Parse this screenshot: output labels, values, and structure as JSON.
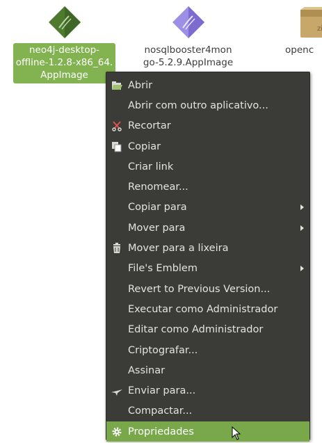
{
  "desktop": {
    "files": [
      {
        "name": "neo4j-desktop-\noffline-1.2.8-x86_64.\nAppImage",
        "icon": "neo4j-diamond-icon",
        "icon_color": "#4e7a2f",
        "selected": true
      },
      {
        "name": "nosqlbooster4mon\ngo-5.2.9.AppImage",
        "icon": "nosqlbooster-diamond-icon",
        "icon_color": "#8a7ad8",
        "selected": false
      },
      {
        "name": "openc",
        "icon": "zip-archive-icon",
        "icon_color": "#c8a86a",
        "selected": false
      }
    ],
    "zip_icon_text": "zip"
  },
  "context_menu": {
    "items": [
      {
        "label": "Abrir",
        "icon": "open-icon",
        "submenu": false
      },
      {
        "label": "Abrir com outro aplicativo...",
        "icon": "",
        "submenu": false
      },
      {
        "label": "Recortar",
        "icon": "scissors-icon",
        "submenu": false
      },
      {
        "label": "Copiar",
        "icon": "copy-icon",
        "submenu": false
      },
      {
        "label": "Criar link",
        "icon": "",
        "submenu": false
      },
      {
        "label": "Renomear...",
        "icon": "",
        "submenu": false
      },
      {
        "label": "Copiar para",
        "icon": "",
        "submenu": true
      },
      {
        "label": "Mover para",
        "icon": "",
        "submenu": true
      },
      {
        "label": "Mover para a lixeira",
        "icon": "trash-icon",
        "submenu": false
      },
      {
        "label": "File's Emblem",
        "icon": "",
        "submenu": true
      },
      {
        "label": "Revert to Previous Version...",
        "icon": "",
        "submenu": false
      },
      {
        "label": "Executar como Administrador",
        "icon": "",
        "submenu": false
      },
      {
        "label": "Editar como Administrador",
        "icon": "",
        "submenu": false
      },
      {
        "label": "Criptografar...",
        "icon": "",
        "submenu": false
      },
      {
        "label": "Assinar",
        "icon": "",
        "submenu": false
      },
      {
        "label": "Enviar para...",
        "icon": "send-icon",
        "submenu": false
      },
      {
        "label": "Compactar...",
        "icon": "",
        "submenu": false
      },
      {
        "label": "Propriedades",
        "icon": "gear-icon",
        "submenu": false,
        "highlighted": true
      }
    ]
  },
  "colors": {
    "menu_bg": "#3b3b37",
    "menu_text": "#e4e4de",
    "highlight": "#79a84a",
    "selection": "#82b350"
  }
}
